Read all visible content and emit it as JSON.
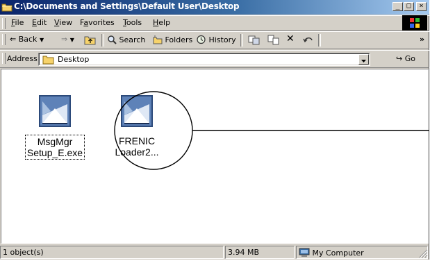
{
  "window": {
    "title": "C:\\Documents and Settings\\Default User\\Desktop",
    "controls": {
      "minimize": "_",
      "maximize": "□",
      "close": "×"
    }
  },
  "menu": [
    {
      "label": "File",
      "underline": "F",
      "rest": "ile"
    },
    {
      "label": "Edit",
      "underline": "E",
      "rest": "dit"
    },
    {
      "label": "View",
      "underline": "V",
      "rest": "iew"
    },
    {
      "label": "Favorites",
      "underline": "a",
      "pre": "F",
      "rest": "vorites"
    },
    {
      "label": "Tools",
      "underline": "T",
      "rest": "ools"
    },
    {
      "label": "Help",
      "underline": "H",
      "rest": "elp"
    }
  ],
  "toolbar": {
    "back_label": "Back",
    "search_label": "Search",
    "folders_label": "Folders",
    "history_label": "History",
    "more": "»"
  },
  "address": {
    "label": "Address",
    "value": "Desktop",
    "go_label": "Go"
  },
  "files": [
    {
      "name_line1": "MsgMgr",
      "name_line2": "Setup_E.exe",
      "selected": true,
      "icon": "installer-icon"
    },
    {
      "name_line1": "FRENIC",
      "name_line2": "Loader2...",
      "selected": false,
      "icon": "installer-icon"
    }
  ],
  "status": {
    "objects": "1 object(s)",
    "size": "3.94 MB",
    "zone": "My Computer"
  },
  "colors": {
    "title_start": "#0a246a",
    "title_end": "#a6caf0",
    "chrome": "#d4d0c8"
  }
}
